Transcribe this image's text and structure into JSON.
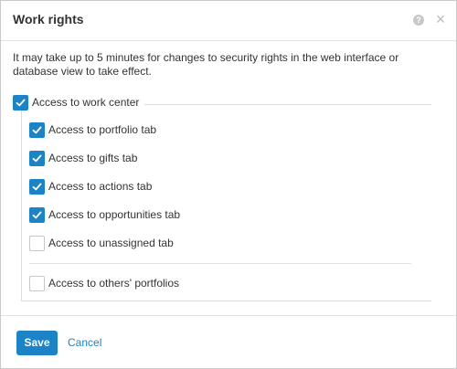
{
  "dialog": {
    "title": "Work rights",
    "help_icon": "question-circle-icon",
    "close_icon": "close-x-icon",
    "notice": "It may take up to 5 minutes for changes to security rights in the web interface or database view to take effect."
  },
  "permissions": {
    "work_center": {
      "label": "Access to work center",
      "checked": true
    },
    "items": [
      {
        "label": "Access to portfolio tab",
        "checked": true
      },
      {
        "label": "Access to gifts tab",
        "checked": true
      },
      {
        "label": "Access to actions tab",
        "checked": true
      },
      {
        "label": "Access to opportunities tab",
        "checked": true
      },
      {
        "label": "Access to unassigned tab",
        "checked": false
      }
    ],
    "others_portfolios": {
      "label": "Access to others' portfolios",
      "checked": false
    }
  },
  "footer": {
    "save_label": "Save",
    "cancel_label": "Cancel"
  },
  "colors": {
    "accent": "#1c84c6",
    "border": "#c9c9c9"
  }
}
